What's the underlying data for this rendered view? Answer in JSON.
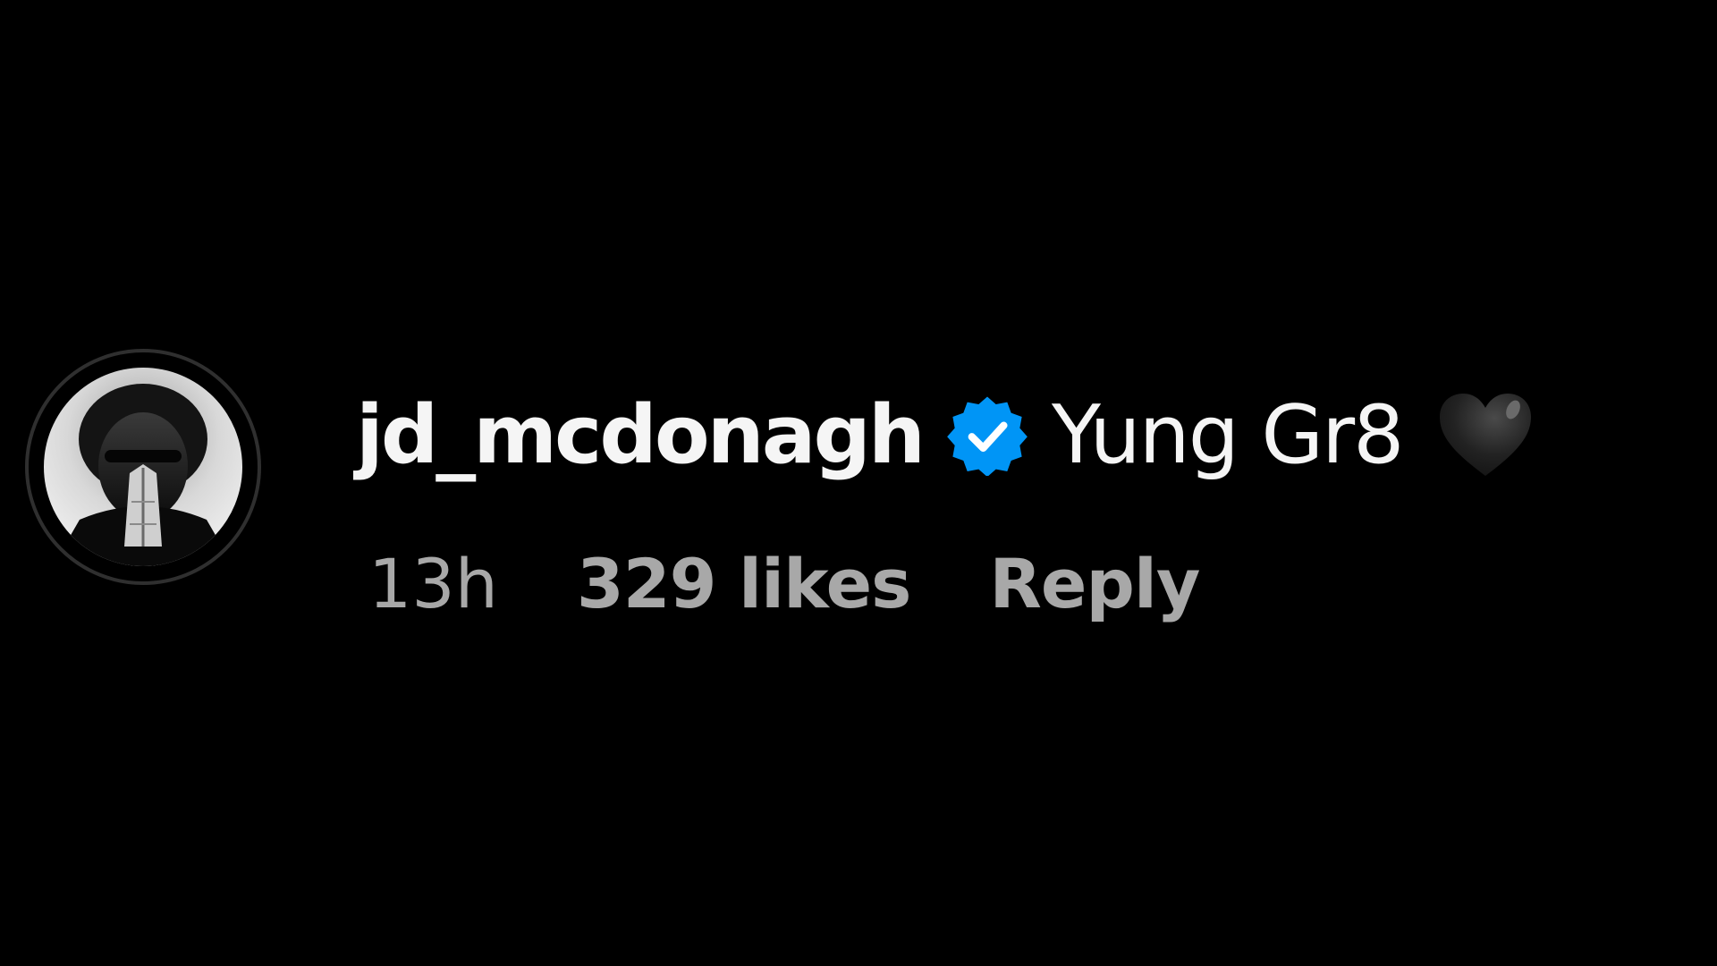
{
  "comment": {
    "username": "jd_mcdonagh",
    "verified_icon": "verified-badge-icon",
    "text": "Yung Gr8",
    "emoji_icon": "black-heart-icon",
    "time": "13h",
    "likes": "329 likes",
    "reply_label": "Reply"
  },
  "colors": {
    "background": "#000000",
    "primary_text": "#f5f5f5",
    "secondary_text": "#a8a8a8",
    "verified_blue": "#0095f6"
  }
}
